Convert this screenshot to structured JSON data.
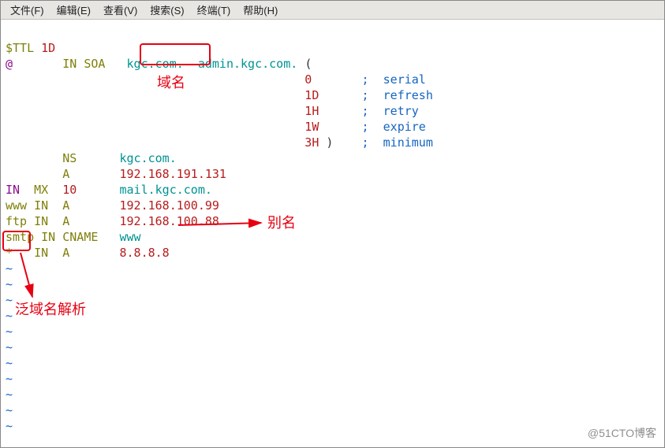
{
  "menubar": {
    "file": "文件(F)",
    "edit": "编辑(E)",
    "view": "查看(V)",
    "search": "搜索(S)",
    "terminal": "终端(T)",
    "help": "帮助(H)"
  },
  "zone": {
    "ttl_directive": "$TTL",
    "ttl_value": "1D",
    "origin": "@",
    "class": "IN",
    "soa": "SOA",
    "primary_ns": "kgc.com.",
    "admin_mail": "admin.kgc.com.",
    "paren_open": "(",
    "paren_close": ")",
    "soa_params": [
      {
        "value": "0",
        "comment": "serial"
      },
      {
        "value": "1D",
        "comment": "refresh"
      },
      {
        "value": "1H",
        "comment": "retry"
      },
      {
        "value": "1W",
        "comment": "expire"
      },
      {
        "value": "3H",
        "comment": "minimum"
      }
    ],
    "records": [
      {
        "name": "",
        "class": "",
        "type": "NS",
        "prio": "",
        "value": "kgc.com."
      },
      {
        "name": "",
        "class": "",
        "type": "A",
        "prio": "",
        "value": "192.168.191.131"
      },
      {
        "name": "IN",
        "class": "MX",
        "type": "10",
        "prio": "",
        "value": "mail.kgc.com."
      },
      {
        "name": "www",
        "class": "IN",
        "type": "A",
        "prio": "",
        "value": "192.168.100.99"
      },
      {
        "name": "ftp",
        "class": "IN",
        "type": "A",
        "prio": "",
        "value": "192.168.100.88"
      },
      {
        "name": "smtp",
        "class": "IN",
        "type": "CNAME",
        "prio": "",
        "value": "www"
      },
      {
        "name": "*",
        "class": "IN",
        "type": "A",
        "prio": "",
        "value": "8.8.8.8"
      }
    ]
  },
  "comment_sep": ";",
  "tilde": "~",
  "annotations": {
    "domain_label": "域名",
    "alias_label": "别名",
    "wildcard_label": "泛域名解析"
  },
  "watermark": "@51CTO博客"
}
